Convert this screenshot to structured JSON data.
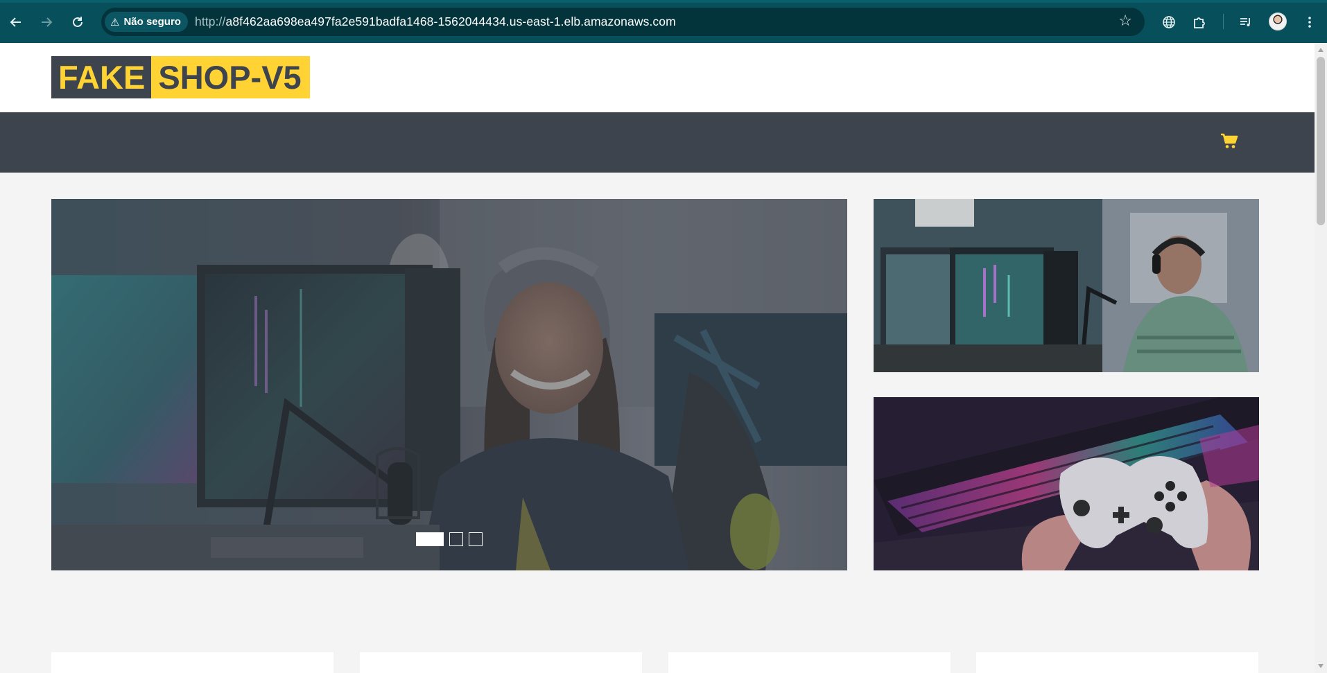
{
  "browser": {
    "back_icon": "arrow-left-icon",
    "forward_icon": "arrow-right-icon",
    "reload_icon": "reload-icon",
    "security_label": "Não seguro",
    "url_scheme": "http://",
    "url_host": "a8f462aa698ea497fa2e591badfa1468-1562044434.us-east-1.elb.amazonaws.com",
    "bookmark_icon": "star-icon",
    "toolbar_icons": [
      "translate-icon",
      "extensions-icon",
      "media-control-icon",
      "profile-avatar",
      "menu-dots-icon"
    ]
  },
  "site": {
    "logo_part1": "FAKE",
    "logo_part2": "SHOP-V5",
    "cart_icon": "shopping-cart-icon",
    "accent_color": "#ffd333",
    "dark_color": "#3d444d"
  },
  "carousel": {
    "slides": 3,
    "active_index": 0
  }
}
